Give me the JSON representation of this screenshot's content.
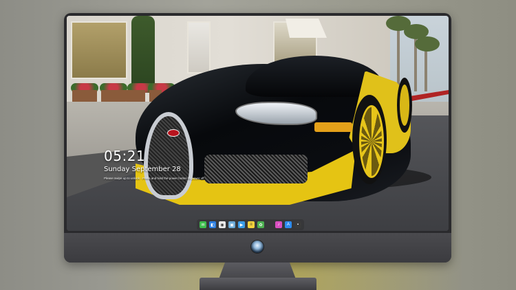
{
  "lock_screen": {
    "time": "05:21",
    "date": "Sunday September 28",
    "hint": "Please swipe up to unlock · Press and hold the power button to power off"
  },
  "dock": {
    "apps": [
      {
        "name": "messages-icon",
        "color": "#3ebd4c",
        "glyph": "✉"
      },
      {
        "name": "finder-icon",
        "color": "#2e7fe0",
        "glyph": "◧"
      },
      {
        "name": "chrome-icon",
        "color": "#e9e9e9",
        "glyph": "◉"
      },
      {
        "name": "preview-icon",
        "color": "#6aa9d6",
        "glyph": "▣"
      },
      {
        "name": "videos-icon",
        "color": "#3a9de8",
        "glyph": "▶"
      },
      {
        "name": "notes-icon",
        "color": "#f4d23c",
        "glyph": "≡"
      },
      {
        "name": "photos-icon",
        "color": "#4caf50",
        "glyph": "✿"
      },
      {
        "name": "music-icon",
        "color": "#d94fc0",
        "glyph": "♪"
      },
      {
        "name": "app-store-icon",
        "color": "#2d8cf0",
        "glyph": "A"
      },
      {
        "name": "terminal-icon",
        "color": "#3a3a3a",
        "glyph": "▪"
      }
    ]
  },
  "colors": {
    "monitor_frame": "#2a2a2d",
    "car_yellow": "#e5c413",
    "car_black": "#07090c"
  }
}
